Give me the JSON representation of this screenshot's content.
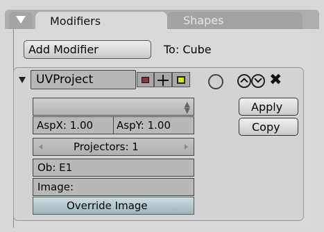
{
  "tabs": [
    {
      "label": "Modifiers",
      "active": true
    },
    {
      "label": "Shapes",
      "active": false
    }
  ],
  "header": {
    "add_modifier_label": "Add Modifier",
    "target_label": "To: Cube"
  },
  "modifier": {
    "name": "UVProject",
    "icons": [
      "render-icon",
      "realtime-icon",
      "editmode-icon",
      "cage-icon",
      "move-up-icon",
      "move-down-icon",
      "delete-icon"
    ],
    "delete_glyph": "✖",
    "apply_label": "Apply",
    "copy_label": "Copy",
    "aspx_label": "AspX: 1.00",
    "aspy_label": "AspY: 1.00",
    "projectors_label": "Projectors: 1",
    "ob_label": "Ob: E1",
    "image_label": "Image:",
    "override_label": "Override Image"
  },
  "colors": {
    "panel_bg": "#d9d9d9",
    "editmode_accent": "#e1e800",
    "override_button": "#9cb5bc"
  }
}
